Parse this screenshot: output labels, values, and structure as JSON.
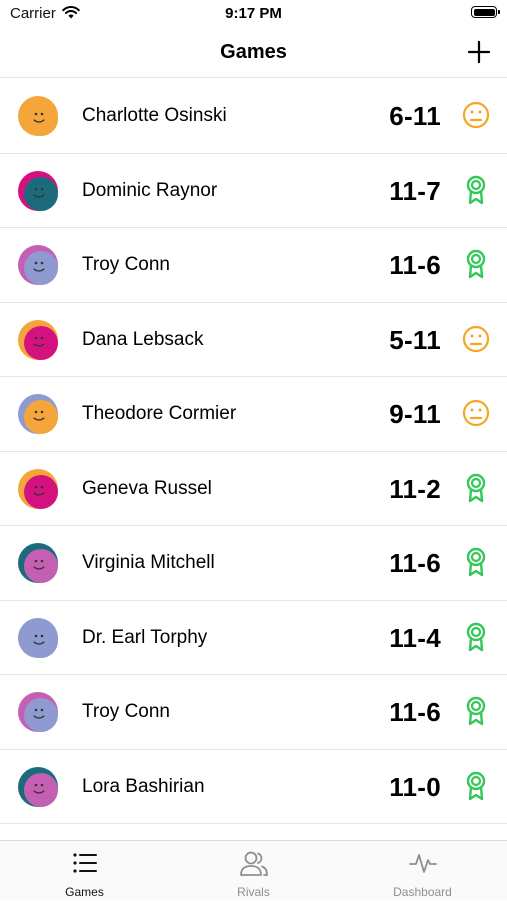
{
  "status_bar": {
    "carrier": "Carrier",
    "time": "9:17 PM"
  },
  "nav": {
    "title": "Games"
  },
  "colors": {
    "win": "#34c759",
    "loss": "#f5a623",
    "divider": "#e6e6e6"
  },
  "games": [
    {
      "opponent": "Charlotte Osinski",
      "score": "6-11",
      "result": "loss",
      "avatar": [
        "#f5a63a",
        "#f5a63a"
      ]
    },
    {
      "opponent": "Dominic Raynor",
      "score": "11-7",
      "result": "win",
      "avatar": [
        "#d4127f",
        "#1c6b7c"
      ]
    },
    {
      "opponent": "Troy Conn",
      "score": "11-6",
      "result": "win",
      "avatar": [
        "#c45fb3",
        "#8e9ad0"
      ]
    },
    {
      "opponent": "Dana Lebsack",
      "score": "5-11",
      "result": "loss",
      "avatar": [
        "#f5a63a",
        "#d4127f"
      ]
    },
    {
      "opponent": "Theodore Cormier",
      "score": "9-11",
      "result": "loss",
      "avatar": [
        "#8e9ad0",
        "#f5a63a"
      ]
    },
    {
      "opponent": "Geneva Russel",
      "score": "11-2",
      "result": "win",
      "avatar": [
        "#f5a63a",
        "#d4127f"
      ]
    },
    {
      "opponent": "Virginia Mitchell",
      "score": "11-6",
      "result": "win",
      "avatar": [
        "#1c6b7c",
        "#c45fb3"
      ]
    },
    {
      "opponent": "Dr. Earl Torphy",
      "score": "11-4",
      "result": "win",
      "avatar": [
        "#8e9ad0",
        "#8e9ad0"
      ]
    },
    {
      "opponent": "Troy Conn",
      "score": "11-6",
      "result": "win",
      "avatar": [
        "#c45fb3",
        "#8e9ad0"
      ]
    },
    {
      "opponent": "Lora Bashirian",
      "score": "11-0",
      "result": "win",
      "avatar": [
        "#1c6b7c",
        "#c45fb3"
      ]
    }
  ],
  "tabs": [
    {
      "label": "Games",
      "icon": "list-icon",
      "active": true
    },
    {
      "label": "Rivals",
      "icon": "people-icon",
      "active": false
    },
    {
      "label": "Dashboard",
      "icon": "activity-icon",
      "active": false
    }
  ]
}
